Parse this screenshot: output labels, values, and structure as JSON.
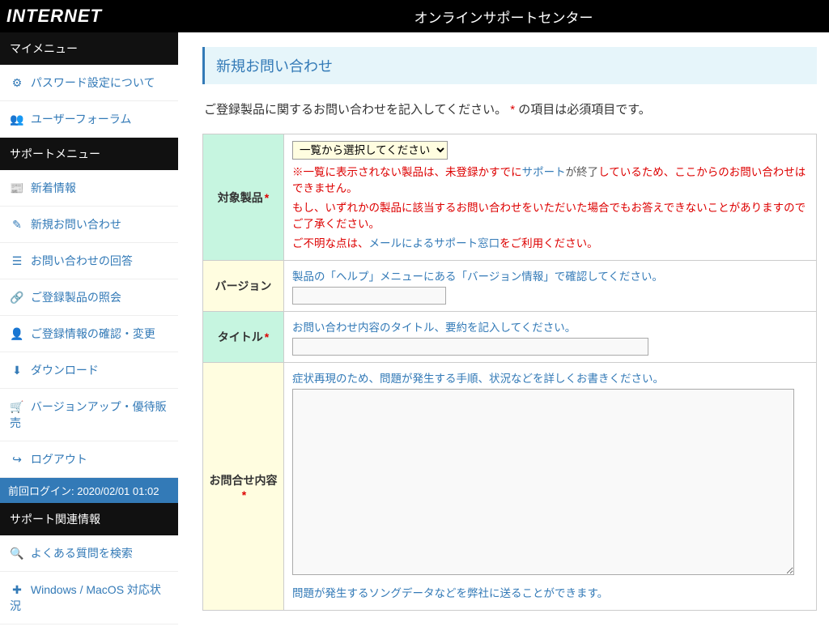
{
  "header": {
    "brand": "INTERNET",
    "center_title": "オンラインサポートセンター"
  },
  "sidebar": {
    "groups": [
      {
        "title": "マイメニュー",
        "items": [
          {
            "icon": "⚙",
            "label": "パスワード設定について"
          },
          {
            "icon": "👥",
            "label": "ユーザーフォーラム"
          }
        ]
      },
      {
        "title": "サポートメニュー",
        "items": [
          {
            "icon": "📰",
            "label": "新着情報"
          },
          {
            "icon": "✎",
            "label": "新規お問い合わせ"
          },
          {
            "icon": "☰",
            "label": "お問い合わせの回答"
          },
          {
            "icon": "🔗",
            "label": "ご登録製品の照会"
          },
          {
            "icon": "👤",
            "label": "ご登録情報の確認・変更"
          },
          {
            "icon": "⬇",
            "label": "ダウンロード"
          },
          {
            "icon": "🛒",
            "label": "バージョンアップ・優待販売"
          },
          {
            "icon": "↪",
            "label": "ログアウト"
          }
        ],
        "login_info": "前回ログイン: 2020/02/01 01:02"
      },
      {
        "title": "サポート関連情報",
        "items": [
          {
            "icon": "🔍",
            "label": "よくある質問を検索"
          },
          {
            "icon": "✚",
            "label": "Windows / MacOS 対応状況"
          }
        ]
      }
    ]
  },
  "page": {
    "ribbon": "新規お問い合わせ",
    "intro_pre": "ご登録製品に関するお問い合わせを記入してください。",
    "intro_star": "*",
    "intro_post": " の項目は必須項目です。"
  },
  "form": {
    "rows": {
      "product": {
        "label": "対象製品",
        "select_placeholder": "一覧から選択してください",
        "note_p1_a": "※一覧に表示されない製品は、未登録かすでに",
        "note_p1_b": "サポート",
        "note_p1_c": "が終了",
        "note_p1_d": "しているため、ここからのお問い合わせはできません。",
        "note_p2": "もし、いずれかの製品に該当するお問い合わせをいただいた場合でもお答えできないことがありますのでご了承ください。",
        "note_p3_a": "ご不明な点は、",
        "note_p3_b": "メールによるサポート窓口",
        "note_p3_c": "をご利用ください。"
      },
      "version": {
        "label": "バージョン",
        "hint": "製品の「ヘルプ」メニューにある「バージョン情報」で確認してください。"
      },
      "title": {
        "label": "タイトル",
        "hint": "お問い合わせ内容のタイトル、要約を記入してください。"
      },
      "body": {
        "label": "お問合せ内容",
        "hint": "症状再現のため、問題が発生する手順、状況などを詳しくお書きください。",
        "footer_hint": "問題が発生するソングデータなどを弊社に送ることができます。"
      }
    }
  }
}
